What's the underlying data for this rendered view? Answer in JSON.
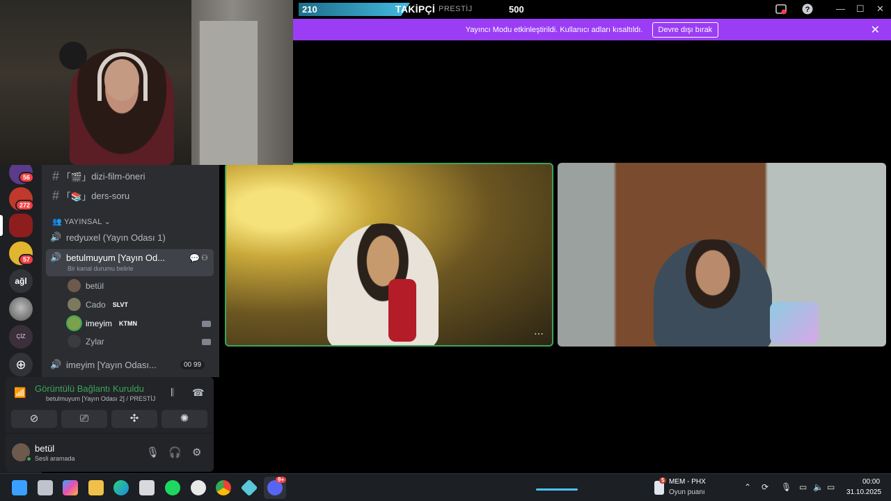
{
  "stream_overlay": {
    "followers_count": "210",
    "title": "TAKİPÇİ",
    "subtitle": "PRESTİJ",
    "goal": "500"
  },
  "banner": {
    "message": "Yayıncı Modu etkinleştirildi. Kullanıcı adları kısaltıldı.",
    "button_label": "Devre dışı bırak",
    "close_glyph": "✕"
  },
  "window_controls": {
    "minimize": "—",
    "maximize": "☐",
    "close": "✕"
  },
  "servers": [
    {
      "badge": "56",
      "color": "#5b3b8a"
    },
    {
      "badge": "272",
      "color": "#c0392b"
    },
    {
      "badge": "",
      "color": "#8e1d1d"
    },
    {
      "badge": "57",
      "color": "#e2b52f"
    },
    {
      "label": "ağl",
      "color": "#313338"
    },
    {
      "badge": "",
      "color": "#555"
    },
    {
      "label": "ÇİZ",
      "color": "#3a2f3a"
    }
  ],
  "channels": {
    "text": [
      {
        "name": "dizi-film-öneri",
        "prefix": "｢🎬｣"
      },
      {
        "name": "ders-soru",
        "prefix": "｢📚｣"
      }
    ],
    "category": "YAYINSAL",
    "voice": [
      {
        "name": "redyuxel (Yayın Odası 1)"
      },
      {
        "name": "betulmuyum [Yayın Od...",
        "status": "Bir kanal durumu belirle",
        "active": true
      },
      {
        "name": "imeyim [Yayın Odası...",
        "counts": [
          "00",
          "99"
        ]
      }
    ],
    "members": [
      {
        "name": "betül",
        "tag": ""
      },
      {
        "name": "Cado",
        "tag": "SLVT"
      },
      {
        "name": "imeyim",
        "tag": "KTMN",
        "camera": true
      },
      {
        "name": "Zylar",
        "tag": "",
        "camera": true
      }
    ]
  },
  "voice_panel": {
    "status": "Görüntülü Bağlantı Kuruldu",
    "location": "betulmuyum [Yayın Odası 2] / PRESTİJ"
  },
  "user": {
    "name": "betül",
    "status": "Sesli aramada"
  },
  "taskbar": {
    "weather_title": "MEM - PHX",
    "weather_sub": "Oyun puanı",
    "weather_badge": "5",
    "discord_badge": "9+",
    "time": "00:00",
    "date": "31.10.2025"
  },
  "colors": {
    "banner": "#9b3df5",
    "speaking_border": "#3ba55c",
    "connected_green": "#3ba55c",
    "mention_badge": "#f23f43"
  }
}
